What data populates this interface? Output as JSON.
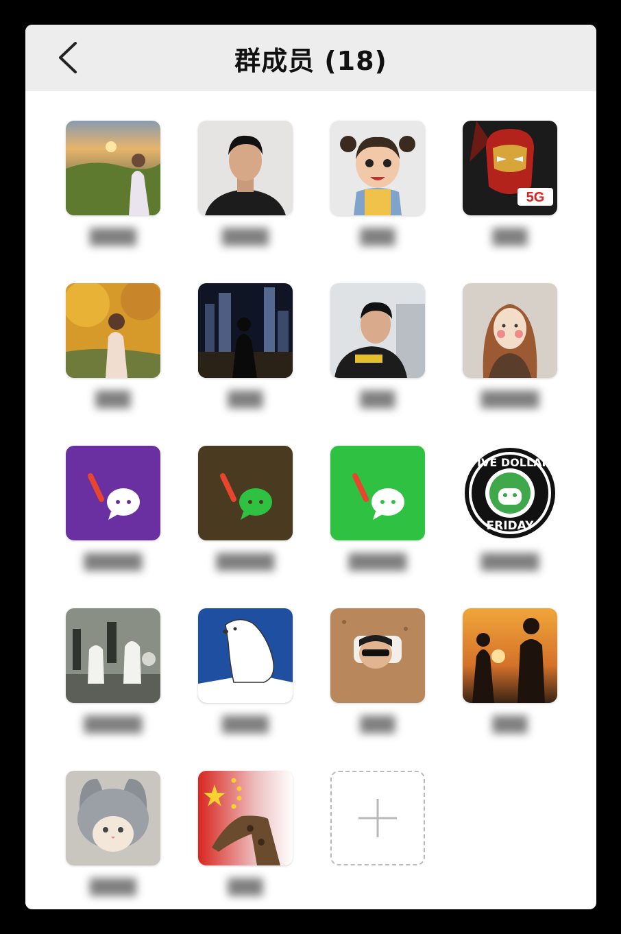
{
  "header": {
    "title": "群成员 (18)"
  },
  "members": [
    {
      "icon": "sunset-field-photo"
    },
    {
      "icon": "man-portrait-photo"
    },
    {
      "icon": "cartoon-girl-avatar"
    },
    {
      "icon": "iron-man-avatar",
      "badge": "5G"
    },
    {
      "icon": "autumn-tree-photo"
    },
    {
      "icon": "city-night-photo"
    },
    {
      "icon": "young-man-photo"
    },
    {
      "icon": "illustrated-woman-avatar"
    },
    {
      "icon": "chat-app-logo-purple"
    },
    {
      "icon": "chat-app-logo-brown"
    },
    {
      "icon": "chat-app-logo-green"
    },
    {
      "icon": "five-dollar-friday-logo",
      "logo_top": "FIVE DOLLAR",
      "logo_bottom": "FRIDAY"
    },
    {
      "icon": "chess-pieces-photo"
    },
    {
      "icon": "polar-bear-drawing"
    },
    {
      "icon": "kid-in-sand-photo"
    },
    {
      "icon": "couple-sunset-photo"
    },
    {
      "icon": "kitten-hat-photo"
    },
    {
      "icon": "flag-giraffe-avatar"
    }
  ],
  "add_button": {
    "icon": "plus-icon"
  },
  "colors": {
    "header_bg": "#ededed",
    "accent_green": "#2fc141"
  }
}
